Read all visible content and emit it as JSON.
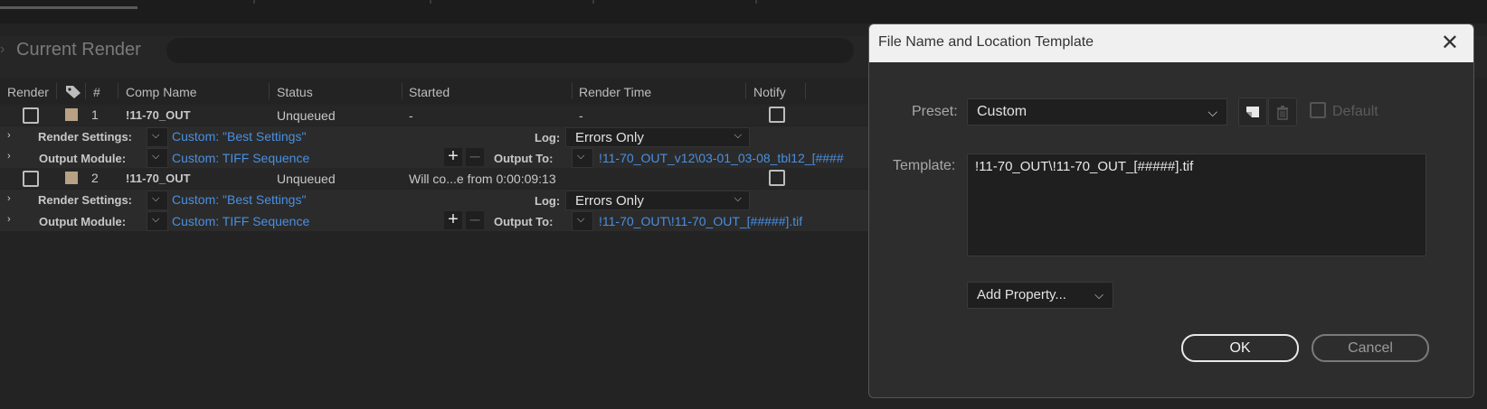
{
  "panel": {
    "title": "Current Render"
  },
  "columns": [
    "Render",
    "#",
    "Comp Name",
    "Status",
    "Started",
    "Render Time",
    "Notify"
  ],
  "items": [
    {
      "num": "1",
      "comp": "!11-70_OUT",
      "status": "Unqueued",
      "started": "-",
      "render_time": "-",
      "render_settings_label": "Render Settings:",
      "render_settings": "Custom: \"Best Settings\"",
      "log_label": "Log:",
      "log": "Errors Only",
      "output_module_label": "Output Module:",
      "output_module": "Custom: TIFF Sequence",
      "output_to_label": "Output To:",
      "output_to": "!11-70_OUT_v12\\03-01_03-08_tbl12_[####"
    },
    {
      "num": "2",
      "comp": "!11-70_OUT",
      "status": "Unqueued",
      "started": "Will co...e from 0:00:09:13",
      "render_time": "",
      "render_settings_label": "Render Settings:",
      "render_settings": "Custom: \"Best Settings\"",
      "log_label": "Log:",
      "log": "Errors Only",
      "output_module_label": "Output Module:",
      "output_module": "Custom: TIFF Sequence",
      "output_to_label": "Output To:",
      "output_to": "!11-70_OUT\\!11-70_OUT_[#####].tif"
    }
  ],
  "dialog": {
    "title": "File Name and Location Template",
    "preset_label": "Preset:",
    "preset_value": "Custom",
    "default_label": "Default",
    "template_label": "Template:",
    "template_value": "!11-70_OUT\\!11-70_OUT_[#####].tif",
    "add_property": "Add Property...",
    "ok": "OK",
    "cancel": "Cancel"
  },
  "colors": {
    "link": "#4a8fe0",
    "label_swatch": "#b8a184",
    "background": "#232323"
  }
}
